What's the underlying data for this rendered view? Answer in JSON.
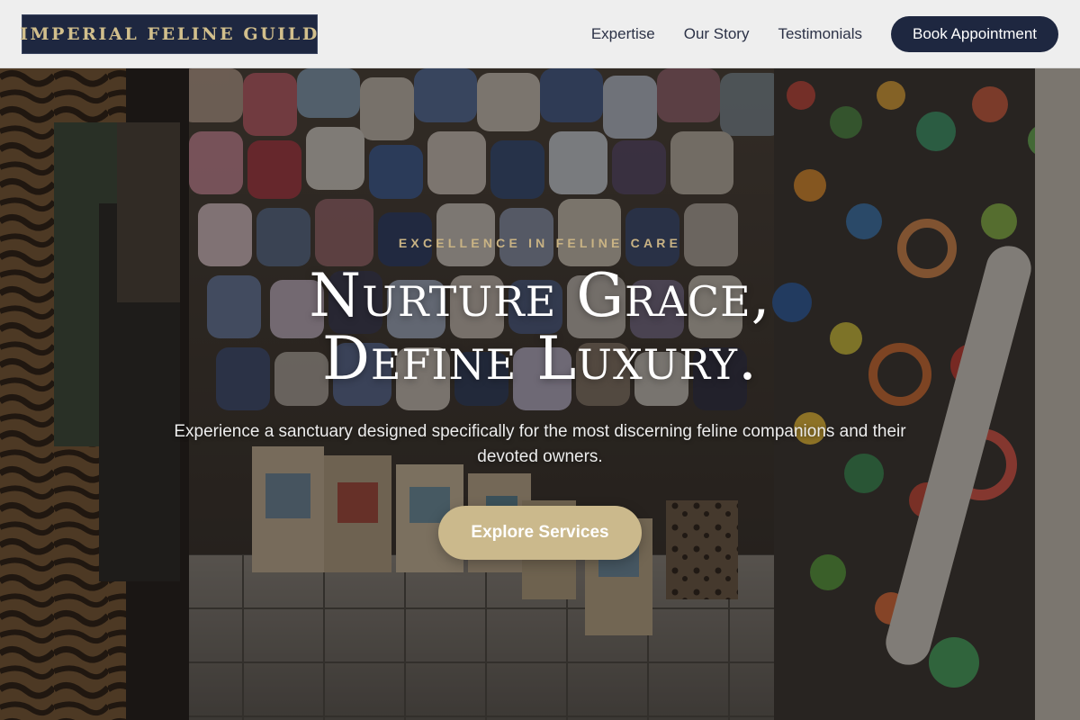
{
  "header": {
    "logo_text": "IMPERIAL FELINE GUILD",
    "nav": [
      {
        "label": "Expertise"
      },
      {
        "label": "Our Story"
      },
      {
        "label": "Testimonials"
      }
    ],
    "cta_label": "Book Appointment"
  },
  "hero": {
    "eyebrow": "EXCELLENCE IN FELINE CARE",
    "headline_line1": "Nurture Grace,",
    "headline_line2": "Define Luxury.",
    "subtext": "Experience a sanctuary designed specifically for the most discerning feline companions and their devoted owners.",
    "button_label": "Explore Services",
    "background_icon": "pet-shop-photo"
  },
  "colors": {
    "navy": "#1e2740",
    "gold": "#cbb98c",
    "gold_text": "#c9b384",
    "header_bg": "#f5f5f5"
  }
}
